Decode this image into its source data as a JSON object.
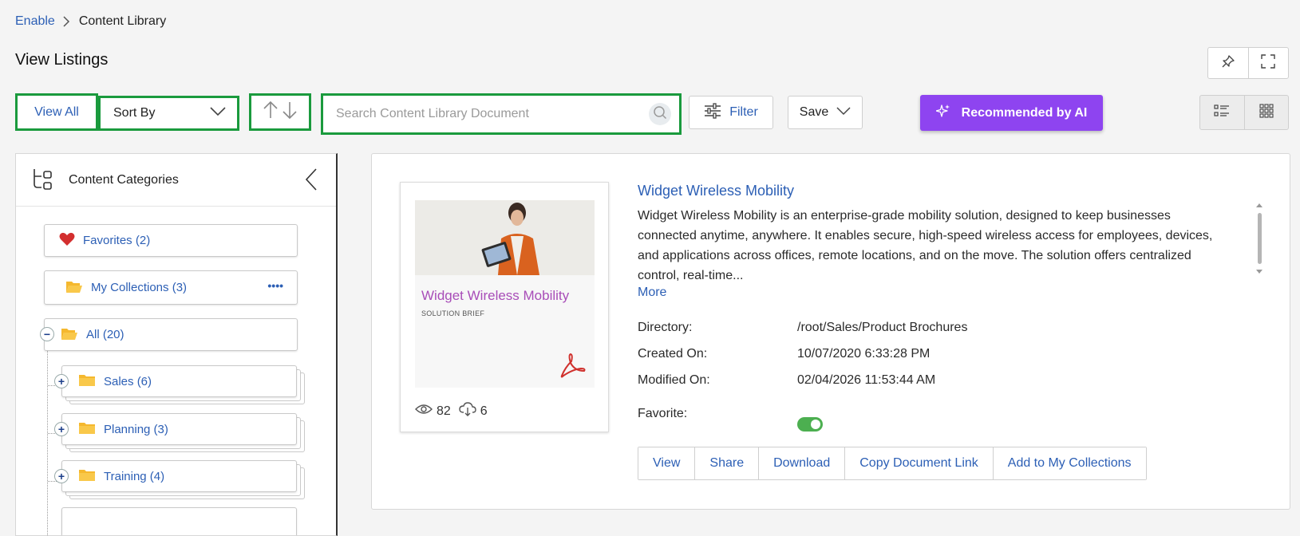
{
  "breadcrumb": {
    "root": "Enable",
    "current": "Content Library"
  },
  "page_title": "View Listings",
  "toolbar": {
    "view_all": "View All",
    "sort_by": "Sort By",
    "search_placeholder": "Search Content Library Document",
    "filter": "Filter",
    "save": "Save",
    "ai": "Recommended by AI"
  },
  "icons": {
    "pin": "pin-icon",
    "fullscreen": "fullscreen-icon",
    "sort_asc": "arrow-up-icon",
    "sort_desc": "arrow-down-icon",
    "search": "search-icon",
    "filter": "sliders-icon",
    "sparkle": "sparkle-icon",
    "list_view": "list-view-icon",
    "grid_view": "grid-view-icon",
    "categories": "categories-icon",
    "collapse": "chevron-left-icon",
    "heart": "heart-icon",
    "folder": "folder-icon",
    "pdf": "pdf-icon",
    "eye": "eye-icon",
    "download": "cloud-download-icon"
  },
  "colors": {
    "accent": "#2c5fb5",
    "ai_button": "#8e44f0",
    "highlight_border": "#1a9a3d",
    "toggle_on": "#4caf50",
    "folder": "#f5b82e",
    "heart": "#d32f2f"
  },
  "sidebar": {
    "title": "Content Categories",
    "favorites": "Favorites (2)",
    "collections": "My Collections (3)",
    "collections_menu": "••••",
    "all": "All (20)",
    "all_toggle": "−",
    "children": [
      {
        "label": "Sales (6)",
        "toggle": "+"
      },
      {
        "label": "Planning (3)",
        "toggle": "+"
      },
      {
        "label": "Training (4)",
        "toggle": "+"
      }
    ]
  },
  "document": {
    "title": "Widget Wireless Mobility",
    "thumb_title": "Widget Wireless Mobility",
    "thumb_subtitle": "SOLUTION BRIEF",
    "views": "82",
    "downloads": "6",
    "description": "Widget Wireless Mobility is an enterprise-grade mobility solution, designed to keep businesses connected anytime, anywhere. It enables secure, high-speed wireless access for employees, devices, and applications across offices, remote locations, and on the move. The solution offers centralized control, real-time...",
    "more": "More",
    "meta": {
      "directory_label": "Directory:",
      "directory": "/root/Sales/Product Brochures",
      "created_label": "Created On:",
      "created": "10/07/2020 6:33:28 PM",
      "modified_label": "Modified On:",
      "modified": "02/04/2026 11:53:44 AM",
      "favorite_label": "Favorite:",
      "favorite": true
    },
    "actions": [
      "View",
      "Share",
      "Download",
      "Copy Document Link",
      "Add to My Collections"
    ]
  }
}
